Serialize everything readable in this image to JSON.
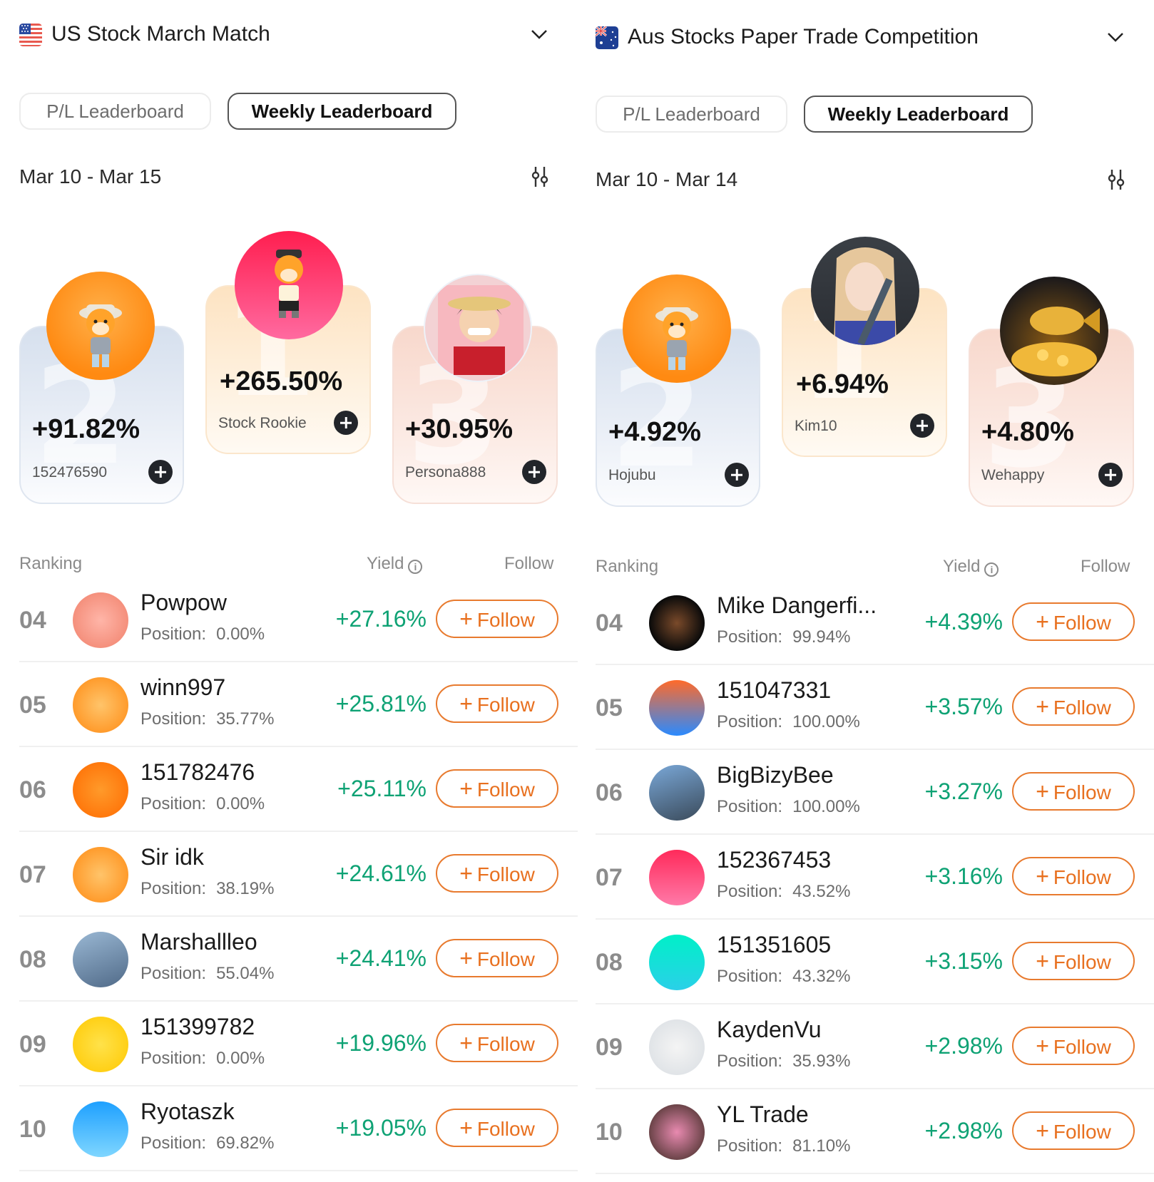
{
  "panels": [
    {
      "competition": {
        "title": "US Stock March Match",
        "flag": "us-flag-icon"
      },
      "tabs": [
        {
          "label": "P/L Leaderboard",
          "active": false
        },
        {
          "label": "Weekly Leaderboard",
          "active": true
        }
      ],
      "date_range": "Mar 10 - Mar 15",
      "podium": {
        "first": {
          "rank": "1",
          "yield": "+265.50%",
          "name": "Stock Rookie"
        },
        "second": {
          "rank": "2",
          "yield": "+91.82%",
          "name": "152476590"
        },
        "third": {
          "rank": "3",
          "yield": "+30.95%",
          "name": "Persona888"
        }
      },
      "list_header": {
        "ranking": "Ranking",
        "yield": "Yield",
        "follow": "Follow"
      },
      "position_label": "Position:",
      "follow_label": "Follow",
      "rows": [
        {
          "rank": "04",
          "name": "Powpow",
          "position": "0.00%",
          "yield": "+27.16%"
        },
        {
          "rank": "05",
          "name": "winn997",
          "position": "35.77%",
          "yield": "+25.81%"
        },
        {
          "rank": "06",
          "name": "151782476",
          "position": "0.00%",
          "yield": "+25.11%"
        },
        {
          "rank": "07",
          "name": "Sir idk",
          "position": "38.19%",
          "yield": "+24.61%"
        },
        {
          "rank": "08",
          "name": "Marshallleo",
          "position": "55.04%",
          "yield": "+24.41%"
        },
        {
          "rank": "09",
          "name": "151399782",
          "position": "0.00%",
          "yield": "+19.96%"
        },
        {
          "rank": "10",
          "name": "Ryotaszk",
          "position": "69.82%",
          "yield": "+19.05%"
        }
      ]
    },
    {
      "competition": {
        "title": "Aus Stocks Paper Trade Competition",
        "flag": "australia-flag-icon"
      },
      "tabs": [
        {
          "label": "P/L Leaderboard",
          "active": false
        },
        {
          "label": "Weekly Leaderboard",
          "active": true
        }
      ],
      "date_range": "Mar 10 - Mar 14",
      "podium": {
        "first": {
          "rank": "1",
          "yield": "+6.94%",
          "name": "Kim10"
        },
        "second": {
          "rank": "2",
          "yield": "+4.92%",
          "name": "Hojubu"
        },
        "third": {
          "rank": "3",
          "yield": "+4.80%",
          "name": "Wehappy"
        }
      },
      "list_header": {
        "ranking": "Ranking",
        "yield": "Yield",
        "follow": "Follow"
      },
      "position_label": "Position:",
      "follow_label": "Follow",
      "rows": [
        {
          "rank": "04",
          "name": "Mike Dangerfi...",
          "position": "99.94%",
          "yield": "+4.39%"
        },
        {
          "rank": "05",
          "name": "151047331",
          "position": "100.00%",
          "yield": "+3.57%"
        },
        {
          "rank": "06",
          "name": "BigBizyBee",
          "position": "100.00%",
          "yield": "+3.27%"
        },
        {
          "rank": "07",
          "name": "152367453",
          "position": "43.52%",
          "yield": "+3.16%"
        },
        {
          "rank": "08",
          "name": "151351605",
          "position": "43.32%",
          "yield": "+3.15%"
        },
        {
          "rank": "09",
          "name": "KaydenVu",
          "position": "35.93%",
          "yield": "+2.98%"
        },
        {
          "rank": "10",
          "name": "YL Trade",
          "position": "81.10%",
          "yield": "+2.98%"
        }
      ]
    }
  ],
  "colors": {
    "positive_yield": "#0ea274",
    "follow_accent": "#e8701f",
    "active_tab_border": "#555555"
  },
  "icons": {
    "dropdown": "chevron-down-icon",
    "filter": "sliders-icon",
    "info": "info-icon",
    "podium_follow": "plus-circle-icon"
  }
}
